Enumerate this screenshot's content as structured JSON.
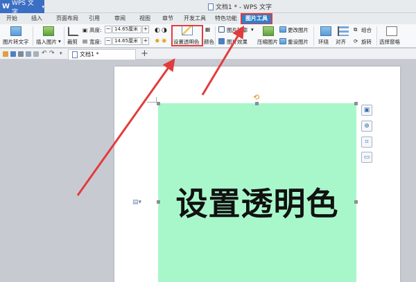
{
  "app": {
    "name": "WPS 文字",
    "logo": "W"
  },
  "window_title": "文档1 * - WPS 文字",
  "tabs": [
    {
      "label": "开始"
    },
    {
      "label": "插入"
    },
    {
      "label": "页面布局"
    },
    {
      "label": "引用"
    },
    {
      "label": "审阅"
    },
    {
      "label": "视图"
    },
    {
      "label": "章节"
    },
    {
      "label": "开发工具"
    },
    {
      "label": "特色功能"
    },
    {
      "label": "图片工具"
    }
  ],
  "ribbon": {
    "pic_to_text": "图片转文字",
    "insert_pic": "插入图片",
    "crop": "裁剪",
    "height_label": "高度:",
    "height_value": "14.65厘米",
    "width_label": "宽度:",
    "width_value": "14.65厘米",
    "set_transparent": "设置透明色",
    "color_label": "颜色",
    "pic_outline": "图片轮廓",
    "pic_effect": "图片效果",
    "compress": "压缩图片",
    "change_pic": "更改图片",
    "reset_pic": "重设图片",
    "wrap": "环绕",
    "align": "对齐",
    "group": "组合",
    "rotate": "旋转",
    "select_pane": "选择窗格",
    "minus": "−",
    "plus": "+"
  },
  "doc_tab": {
    "label": "文档1 *"
  },
  "image_text": "设置透明色",
  "colors": {
    "accent": "#2f80c9",
    "app_blue": "#3b6fc4",
    "image_fill": "#a8f7cb",
    "arrow_red": "#e23b3b"
  }
}
